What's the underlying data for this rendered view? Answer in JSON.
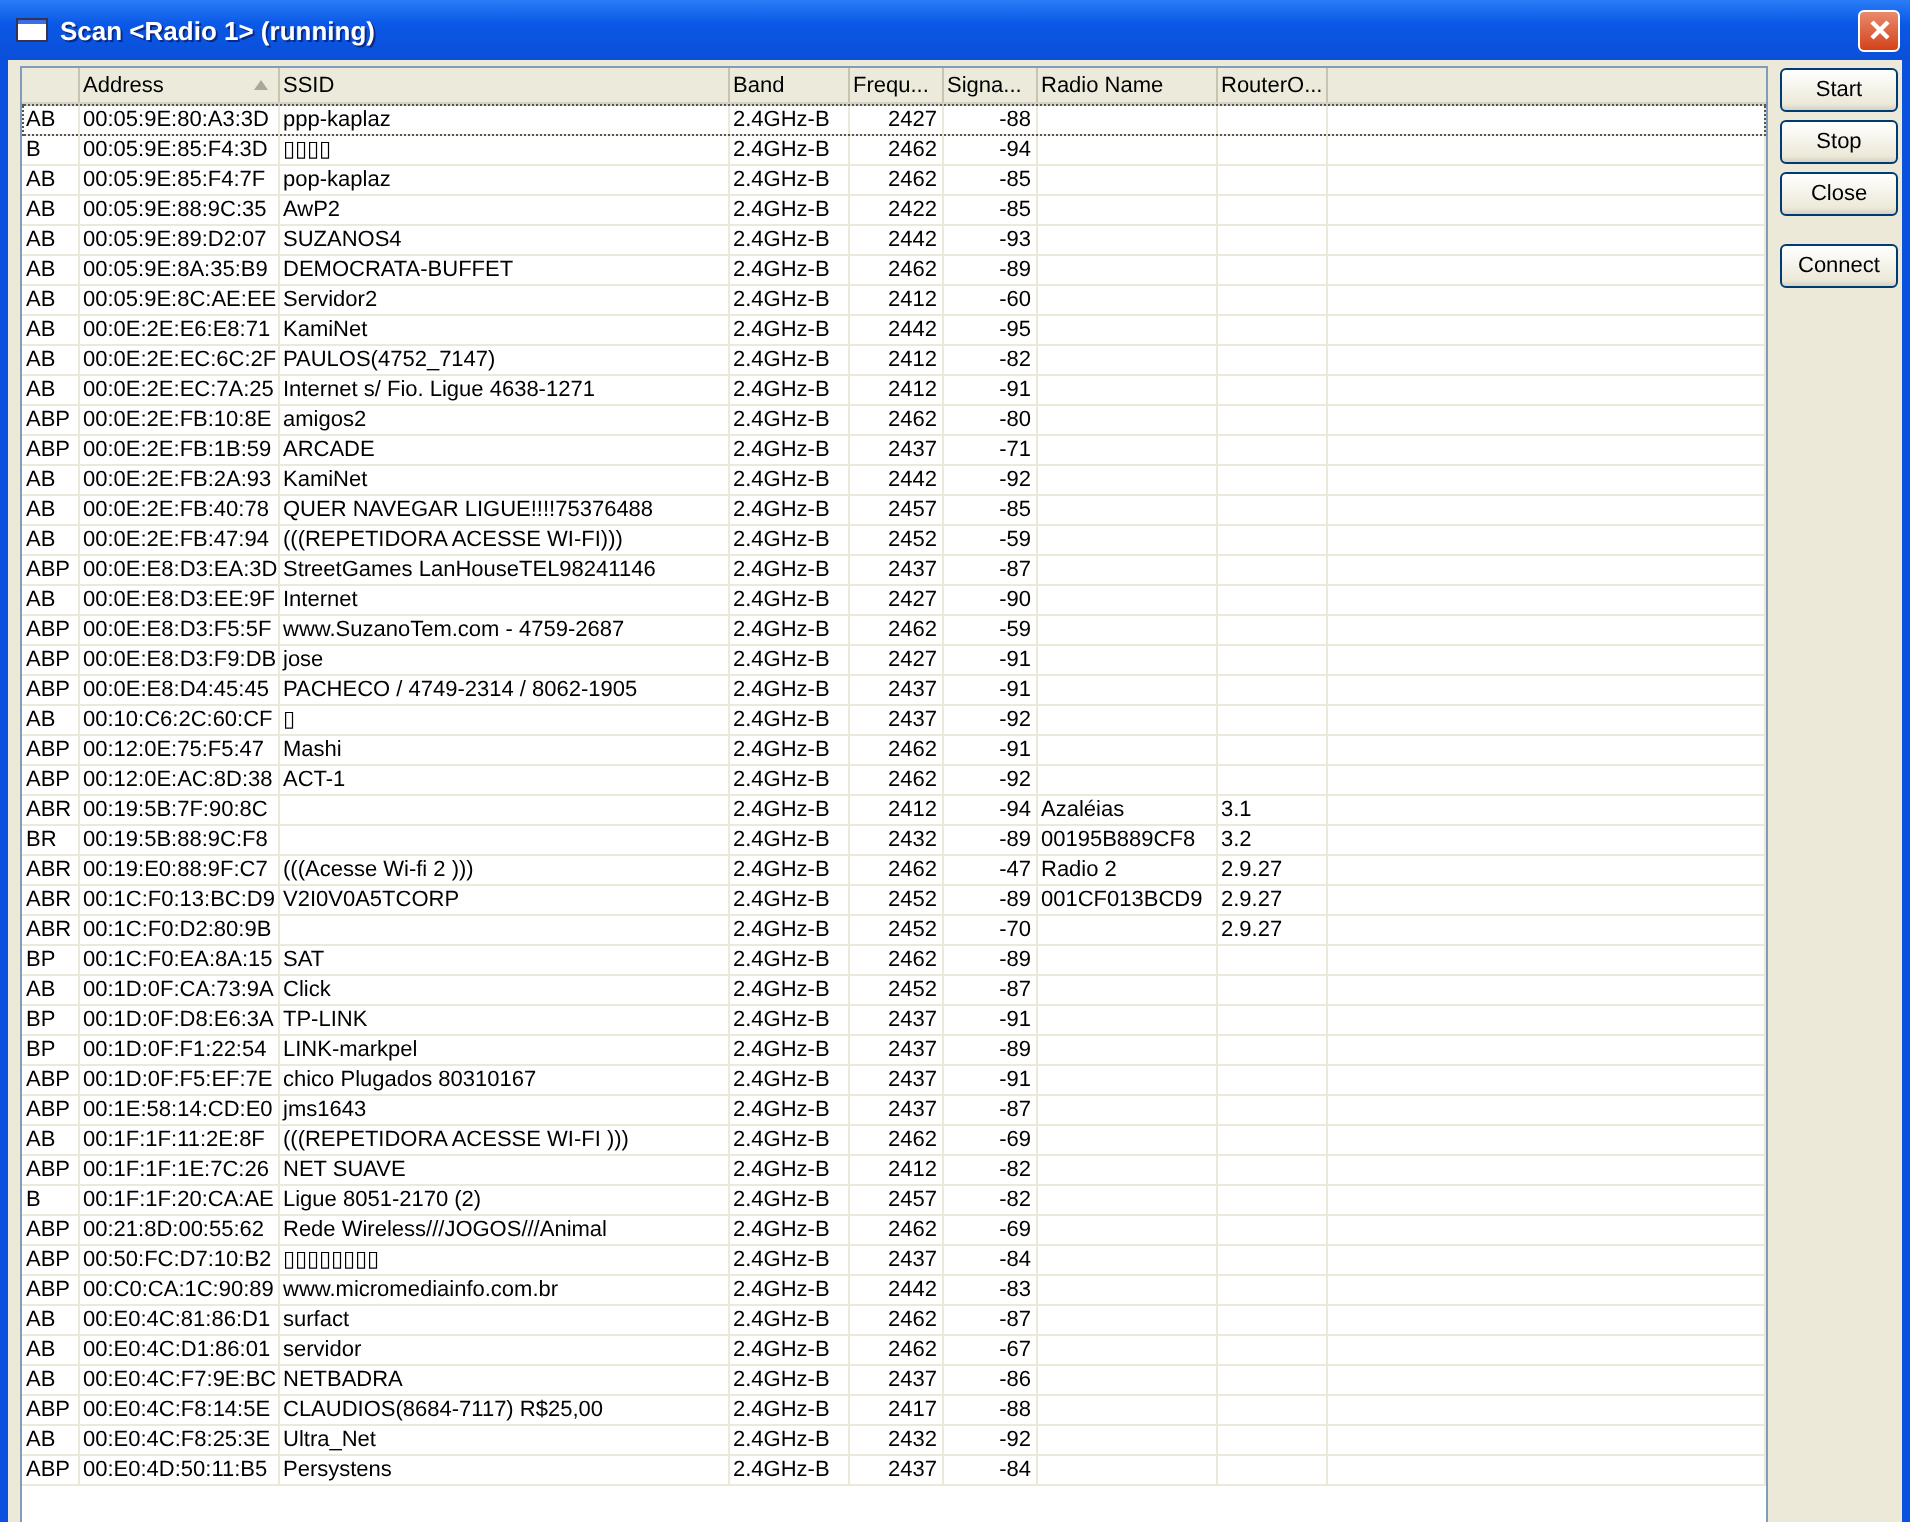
{
  "window": {
    "title": "Scan <Radio 1> (running)"
  },
  "table": {
    "columns": [
      {
        "sorted": false
      },
      {
        "label": "Address",
        "sorted": true
      },
      {
        "label": "SSID",
        "sorted": false
      },
      {
        "label": "Band",
        "sorted": false
      },
      {
        "label": "Frequ...",
        "sorted": false
      },
      {
        "label": "Signa...",
        "sorted": false
      },
      {
        "label": "Radio Name",
        "sorted": false
      },
      {
        "label": "RouterO...",
        "sorted": false
      }
    ],
    "rows": [
      {
        "focused": true,
        "flags": "AB",
        "address": "00:05:9E:80:A3:3D",
        "ssid": "ppp-kaplaz",
        "band": "2.4GHz-B",
        "frequency": "2427",
        "signal": "-88"
      },
      {
        "focused": false,
        "flags": "B",
        "address": "00:05:9E:85:F4:3D",
        "ssid": "▯▯▯▯",
        "band": "2.4GHz-B",
        "frequency": "2462",
        "signal": "-94"
      },
      {
        "focused": false,
        "flags": "AB",
        "address": "00:05:9E:85:F4:7F",
        "ssid": "pop-kaplaz",
        "band": "2.4GHz-B",
        "frequency": "2462",
        "signal": "-85"
      },
      {
        "focused": false,
        "flags": "AB",
        "address": "00:05:9E:88:9C:35",
        "ssid": "AwP2",
        "band": "2.4GHz-B",
        "frequency": "2422",
        "signal": "-85"
      },
      {
        "focused": false,
        "flags": "AB",
        "address": "00:05:9E:89:D2:07",
        "ssid": "SUZANOS4",
        "band": "2.4GHz-B",
        "frequency": "2442",
        "signal": "-93"
      },
      {
        "focused": false,
        "flags": "AB",
        "address": "00:05:9E:8A:35:B9",
        "ssid": "DEMOCRATA-BUFFET",
        "band": "2.4GHz-B",
        "frequency": "2462",
        "signal": "-89"
      },
      {
        "focused": false,
        "flags": "AB",
        "address": "00:05:9E:8C:AE:EE",
        "ssid": "Servidor2",
        "band": "2.4GHz-B",
        "frequency": "2412",
        "signal": "-60"
      },
      {
        "focused": false,
        "flags": "AB",
        "address": "00:0E:2E:E6:E8:71",
        "ssid": "KamiNet",
        "band": "2.4GHz-B",
        "frequency": "2442",
        "signal": "-95"
      },
      {
        "focused": false,
        "flags": "AB",
        "address": "00:0E:2E:EC:6C:2F",
        "ssid": "PAULOS(4752_7147)",
        "band": "2.4GHz-B",
        "frequency": "2412",
        "signal": "-82"
      },
      {
        "focused": false,
        "flags": "AB",
        "address": "00:0E:2E:EC:7A:25",
        "ssid": "Internet s/ Fio. Ligue 4638-1271",
        "band": "2.4GHz-B",
        "frequency": "2412",
        "signal": "-91"
      },
      {
        "focused": false,
        "flags": "ABP",
        "address": "00:0E:2E:FB:10:8E",
        "ssid": "amigos2",
        "band": "2.4GHz-B",
        "frequency": "2462",
        "signal": "-80"
      },
      {
        "focused": false,
        "flags": "ABP",
        "address": "00:0E:2E:FB:1B:59",
        "ssid": "ARCADE",
        "band": "2.4GHz-B",
        "frequency": "2437",
        "signal": "-71"
      },
      {
        "focused": false,
        "flags": "AB",
        "address": "00:0E:2E:FB:2A:93",
        "ssid": "KamiNet",
        "band": "2.4GHz-B",
        "frequency": "2442",
        "signal": "-92"
      },
      {
        "focused": false,
        "flags": "AB",
        "address": "00:0E:2E:FB:40:78",
        "ssid": "QUER NAVEGAR LIGUE!!!!75376488",
        "band": "2.4GHz-B",
        "frequency": "2457",
        "signal": "-85"
      },
      {
        "focused": false,
        "flags": "AB",
        "address": "00:0E:2E:FB:47:94",
        "ssid": "(((REPETIDORA ACESSE WI-FI)))",
        "band": "2.4GHz-B",
        "frequency": "2452",
        "signal": "-59"
      },
      {
        "focused": false,
        "flags": "ABP",
        "address": "00:0E:E8:D3:EA:3D",
        "ssid": "StreetGames LanHouseTEL98241146",
        "band": "2.4GHz-B",
        "frequency": "2437",
        "signal": "-87"
      },
      {
        "focused": false,
        "flags": "AB",
        "address": "00:0E:E8:D3:EE:9F",
        "ssid": "Internet",
        "band": "2.4GHz-B",
        "frequency": "2427",
        "signal": "-90"
      },
      {
        "focused": false,
        "flags": "ABP",
        "address": "00:0E:E8:D3:F5:5F",
        "ssid": "www.SuzanoTem.com - 4759-2687",
        "band": "2.4GHz-B",
        "frequency": "2462",
        "signal": "-59"
      },
      {
        "focused": false,
        "flags": "ABP",
        "address": "00:0E:E8:D3:F9:DB",
        "ssid": "jose",
        "band": "2.4GHz-B",
        "frequency": "2427",
        "signal": "-91"
      },
      {
        "focused": false,
        "flags": "ABP",
        "address": "00:0E:E8:D4:45:45",
        "ssid": "PACHECO / 4749-2314 / 8062-1905",
        "band": "2.4GHz-B",
        "frequency": "2437",
        "signal": "-91"
      },
      {
        "focused": false,
        "flags": "AB",
        "address": "00:10:C6:2C:60:CF",
        "ssid": "▯",
        "band": "2.4GHz-B",
        "frequency": "2437",
        "signal": "-92"
      },
      {
        "focused": false,
        "flags": "ABP",
        "address": "00:12:0E:75:F5:47",
        "ssid": "Mashi",
        "band": "2.4GHz-B",
        "frequency": "2462",
        "signal": "-91"
      },
      {
        "focused": false,
        "flags": "ABP",
        "address": "00:12:0E:AC:8D:38",
        "ssid": "ACT-1",
        "band": "2.4GHz-B",
        "frequency": "2462",
        "signal": "-92"
      },
      {
        "focused": false,
        "flags": "ABR",
        "address": "00:19:5B:7F:90:8C",
        "band": "2.4GHz-B",
        "frequency": "2412",
        "signal": "-94",
        "radio_name": "Azaléias",
        "router_os": "3.1"
      },
      {
        "focused": false,
        "flags": "BR",
        "address": "00:19:5B:88:9C:F8",
        "band": "2.4GHz-B",
        "frequency": "2432",
        "signal": "-89",
        "radio_name": "00195B889CF8",
        "router_os": "3.2"
      },
      {
        "focused": false,
        "flags": "ABR",
        "address": "00:19:E0:88:9F:C7",
        "ssid": "(((Acesse Wi-fi 2 )))",
        "band": "2.4GHz-B",
        "frequency": "2462",
        "signal": "-47",
        "radio_name": "Radio 2",
        "router_os": "2.9.27"
      },
      {
        "focused": false,
        "flags": "ABR",
        "address": "00:1C:F0:13:BC:D9",
        "ssid": "V2I0V0A5TCORP",
        "band": "2.4GHz-B",
        "frequency": "2452",
        "signal": "-89",
        "radio_name": "001CF013BCD9",
        "router_os": "2.9.27"
      },
      {
        "focused": false,
        "flags": "ABR",
        "address": "00:1C:F0:D2:80:9B",
        "band": "2.4GHz-B",
        "frequency": "2452",
        "signal": "-70",
        "router_os": "2.9.27"
      },
      {
        "focused": false,
        "flags": "BP",
        "address": "00:1C:F0:EA:8A:15",
        "ssid": "SAT",
        "band": "2.4GHz-B",
        "frequency": "2462",
        "signal": "-89"
      },
      {
        "focused": false,
        "flags": "AB",
        "address": "00:1D:0F:CA:73:9A",
        "ssid": "Click",
        "band": "2.4GHz-B",
        "frequency": "2452",
        "signal": "-87"
      },
      {
        "focused": false,
        "flags": "BP",
        "address": "00:1D:0F:D8:E6:3A",
        "ssid": "TP-LINK",
        "band": "2.4GHz-B",
        "frequency": "2437",
        "signal": "-91"
      },
      {
        "focused": false,
        "flags": "BP",
        "address": "00:1D:0F:F1:22:54",
        "ssid": "LINK-markpel",
        "band": "2.4GHz-B",
        "frequency": "2437",
        "signal": "-89"
      },
      {
        "focused": false,
        "flags": "ABP",
        "address": "00:1D:0F:F5:EF:7E",
        "ssid": "chico  Plugados 80310167",
        "band": "2.4GHz-B",
        "frequency": "2437",
        "signal": "-91"
      },
      {
        "focused": false,
        "flags": "ABP",
        "address": "00:1E:58:14:CD:E0",
        "ssid": "jms1643",
        "band": "2.4GHz-B",
        "frequency": "2437",
        "signal": "-87"
      },
      {
        "focused": false,
        "flags": "AB",
        "address": "00:1F:1F:11:2E:8F",
        "ssid": "(((REPETIDORA ACESSE WI-FI )))",
        "band": "2.4GHz-B",
        "frequency": "2462",
        "signal": "-69"
      },
      {
        "focused": false,
        "flags": "ABP",
        "address": "00:1F:1F:1E:7C:26",
        "ssid": "NET SUAVE",
        "band": "2.4GHz-B",
        "frequency": "2412",
        "signal": "-82"
      },
      {
        "focused": false,
        "flags": "B",
        "address": "00:1F:1F:20:CA:AE",
        "ssid": "Ligue 8051-2170 (2)",
        "band": "2.4GHz-B",
        "frequency": "2457",
        "signal": "-82"
      },
      {
        "focused": false,
        "flags": "ABP",
        "address": "00:21:8D:00:55:62",
        "ssid": "Rede Wireless///JOGOS///Animal",
        "band": "2.4GHz-B",
        "frequency": "2462",
        "signal": "-69"
      },
      {
        "focused": false,
        "flags": "ABP",
        "address": "00:50:FC:D7:10:B2",
        "ssid": "▯▯▯▯▯▯▯▯",
        "band": "2.4GHz-B",
        "frequency": "2437",
        "signal": "-84"
      },
      {
        "focused": false,
        "flags": "ABP",
        "address": "00:C0:CA:1C:90:89",
        "ssid": "www.micromediainfo.com.br",
        "band": "2.4GHz-B",
        "frequency": "2442",
        "signal": "-83"
      },
      {
        "focused": false,
        "flags": "AB",
        "address": "00:E0:4C:81:86:D1",
        "ssid": "surfact",
        "band": "2.4GHz-B",
        "frequency": "2462",
        "signal": "-87"
      },
      {
        "focused": false,
        "flags": "AB",
        "address": "00:E0:4C:D1:86:01",
        "ssid": "servidor",
        "band": "2.4GHz-B",
        "frequency": "2462",
        "signal": "-67"
      },
      {
        "focused": false,
        "flags": "AB",
        "address": "00:E0:4C:F7:9E:BC",
        "ssid": "NETBADRA",
        "band": "2.4GHz-B",
        "frequency": "2437",
        "signal": "-86"
      },
      {
        "focused": false,
        "flags": "ABP",
        "address": "00:E0:4C:F8:14:5E",
        "ssid": "CLAUDIOS(8684-7117) R$25,00",
        "band": "2.4GHz-B",
        "frequency": "2417",
        "signal": "-88"
      },
      {
        "focused": false,
        "flags": "AB",
        "address": "00:E0:4C:F8:25:3E",
        "ssid": "Ultra_Net",
        "band": "2.4GHz-B",
        "frequency": "2432",
        "signal": "-92"
      },
      {
        "focused": false,
        "flags": "ABP",
        "address": "00:E0:4D:50:11:B5",
        "ssid": "Persystens",
        "band": "2.4GHz-B",
        "frequency": "2437",
        "signal": "-84"
      }
    ]
  },
  "buttons": [
    {
      "label": "Start"
    },
    {
      "label": "Stop"
    },
    {
      "label": "Close"
    },
    {
      "label": "Connect"
    }
  ]
}
